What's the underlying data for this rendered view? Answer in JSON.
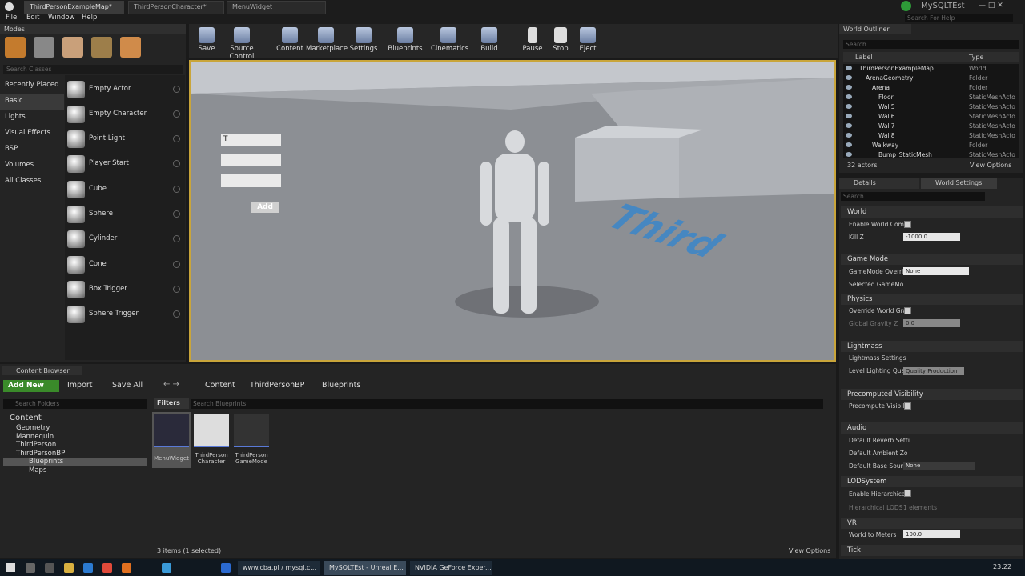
{
  "tabs": [
    "ThirdPersonExampleMap*",
    "ThirdPersonCharacter*",
    "MenuWidget"
  ],
  "project_name": "MySQLTEst",
  "help_search": "Search For Help",
  "menu": [
    "File",
    "Edit",
    "Window",
    "Help"
  ],
  "modes": {
    "title": "Modes",
    "search": "Search Classes",
    "categories": [
      "Recently Placed",
      "Basic",
      "Lights",
      "Visual Effects",
      "BSP",
      "Volumes",
      "All Classes"
    ],
    "selected": "Basic",
    "actors": [
      "Empty Actor",
      "Empty Character",
      "Point Light",
      "Player Start",
      "Cube",
      "Sphere",
      "Cylinder",
      "Cone",
      "Box Trigger",
      "Sphere Trigger"
    ]
  },
  "toolbar": [
    "Save",
    "Source Control",
    "Content",
    "Marketplace",
    "Settings",
    "Blueprints",
    "Cinematics",
    "Build",
    "Pause",
    "Stop",
    "Eject"
  ],
  "viewport": {
    "input_text": "T",
    "add_label": "Add",
    "floor_text": "Third"
  },
  "outliner": {
    "title": "World Outliner",
    "search": "Search",
    "col_label": "Label",
    "col_type": "Type",
    "rows": [
      [
        "ThirdPersonExampleMap",
        "World"
      ],
      [
        "ArenaGeometry",
        "Folder"
      ],
      [
        "Arena",
        "Folder"
      ],
      [
        "Floor",
        "StaticMeshActo"
      ],
      [
        "Wall5",
        "StaticMeshActo"
      ],
      [
        "Wall6",
        "StaticMeshActo"
      ],
      [
        "Wall7",
        "StaticMeshActo"
      ],
      [
        "Wall8",
        "StaticMeshActo"
      ],
      [
        "Walkway",
        "Folder"
      ],
      [
        "Bump_StaticMesh",
        "StaticMeshActo"
      ]
    ],
    "count": "32 actors",
    "view_options": "View Options"
  },
  "details": {
    "tab1": "Details",
    "tab2": "World Settings",
    "search": "Search",
    "sections": [
      "World",
      "Game Mode",
      "Physics",
      "Lightmass",
      "Precomputed Visibility",
      "Audio",
      "LODSystem",
      "VR",
      "Tick"
    ],
    "props": {
      "enable_world_comp": "Enable World Comp",
      "kill_z": "Kill Z",
      "kill_z_val": "-1000.0",
      "gamemode_override": "GameMode Overrid",
      "gamemode_val": "None",
      "selected_gamemode": "Selected GameMo",
      "override_world_grav": "Override World Grav",
      "global_gravity": "Global Gravity Z",
      "global_gravity_val": "0.0",
      "lightmass_settings": "Lightmass Settings",
      "level_lighting": "Level Lighting Qual",
      "level_lighting_val": "Quality Production",
      "precompute_visib": "Precompute Visibil",
      "default_reverb": "Default Reverb Setti",
      "default_ambient": "Default Ambient Zo",
      "default_base_sound": "Default Base Sounc",
      "base_sound_val": "None",
      "enable_hierarchical": "Enable Hierarchical",
      "hierarchical_lods": "Hierarchical LODS",
      "lods_elements": "1 elements",
      "world_to_meters": "World to Meters",
      "world_to_meters_val": "100.0"
    }
  },
  "content_browser": {
    "title": "Content Browser",
    "add_new": "Add New",
    "import": "Import",
    "save_all": "Save All",
    "path": [
      "Content",
      "ThirdPersonBP",
      "Blueprints"
    ],
    "search_folders": "Search Folders",
    "filters": "Filters",
    "search_bp": "Search Blueprints",
    "tree": [
      "Content",
      "Geometry",
      "Mannequin",
      "ThirdPerson",
      "ThirdPersonBP",
      "Blueprints",
      "Maps"
    ],
    "assets": [
      "MenuWidget",
      "ThirdPerson Character",
      "ThirdPerson GameMode"
    ],
    "status": "3 items (1 selected)",
    "view_options": "View Options"
  },
  "taskbar": {
    "buttons": [
      "www.cba.pl / mysql.c...",
      "MySQLTEst - Unreal E...",
      "NVIDIA GeForce Exper..."
    ],
    "time": "23:22"
  }
}
